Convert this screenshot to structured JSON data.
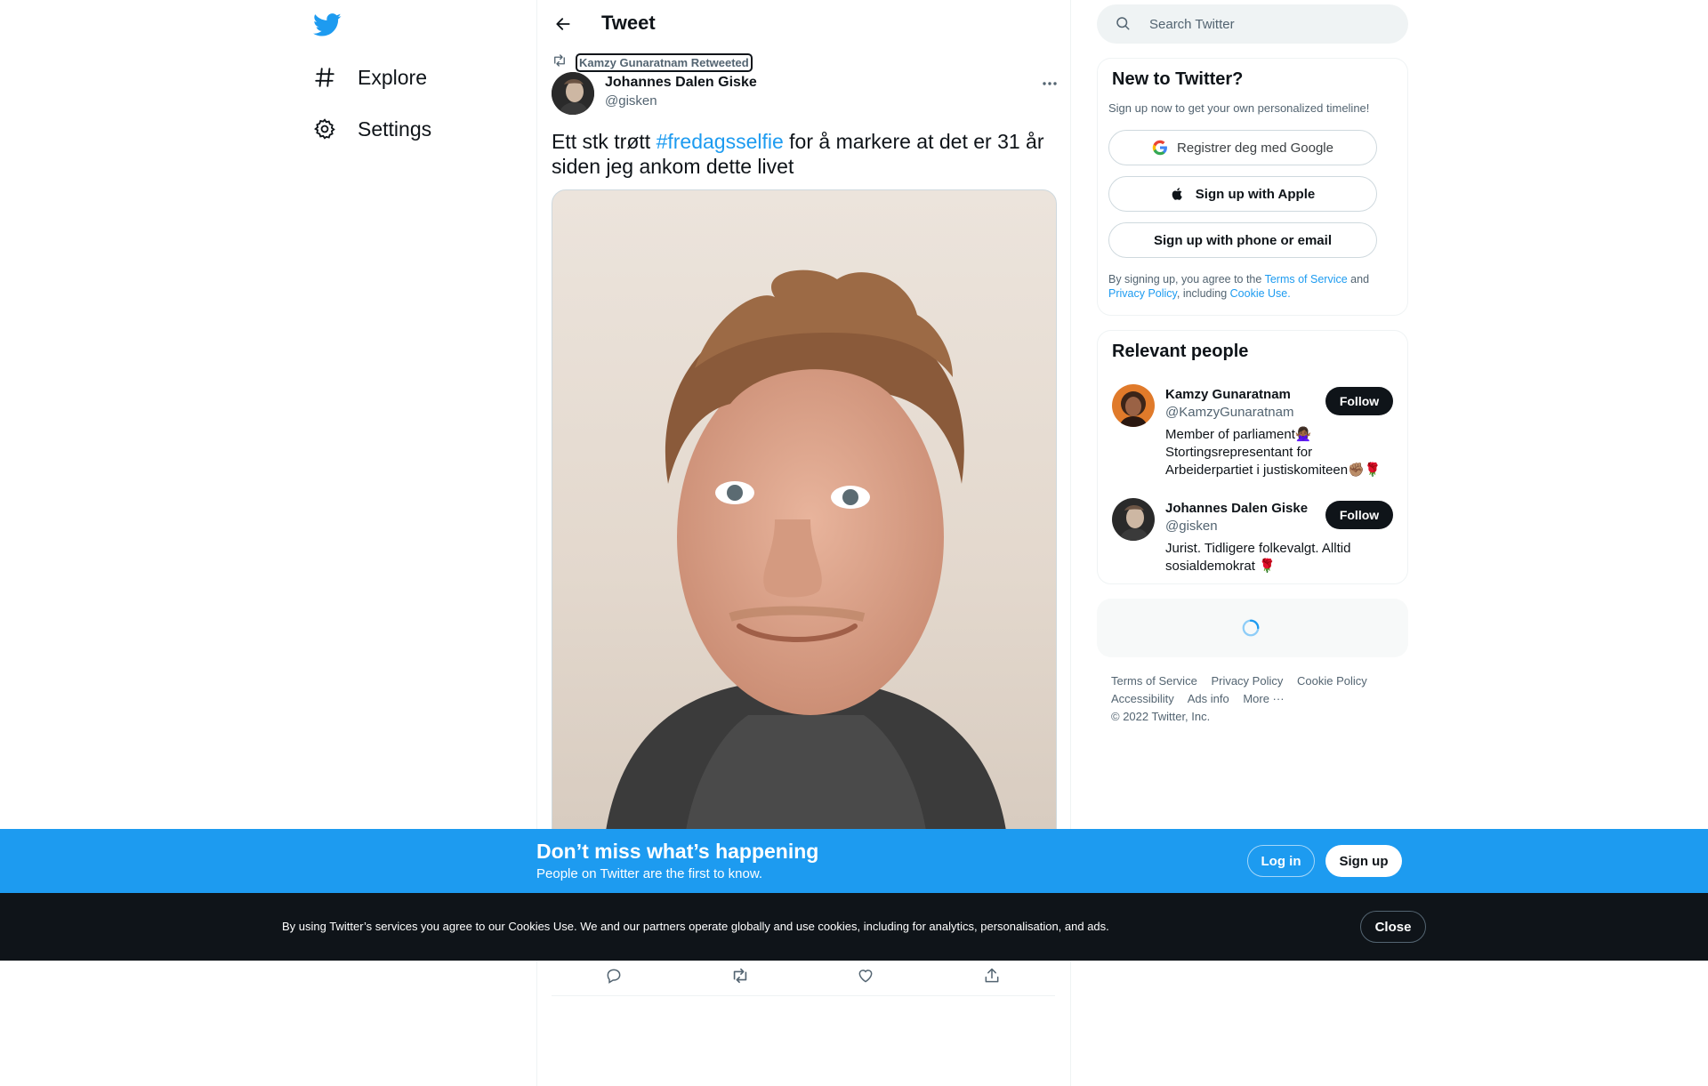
{
  "nav": {
    "items": [
      {
        "label": "Explore",
        "icon": "hashtag-icon"
      },
      {
        "label": "Settings",
        "icon": "gear-icon"
      }
    ]
  },
  "header": {
    "title": "Tweet"
  },
  "tweet": {
    "retweeted_by": "Kamzy Gunaratnam Retweeted",
    "author_name": "Johannes Dalen Giske",
    "author_handle": "@gisken",
    "text_before": "Ett stk trøtt ",
    "hashtag": "#fredagsselfie",
    "text_after": " for å markere at det er 31 år siden jeg ankom dette livet"
  },
  "search": {
    "placeholder": "Search Twitter"
  },
  "new_to_twitter": {
    "title": "New to Twitter?",
    "subtitle": "Sign up now to get your own personalized timeline!",
    "google_label": "Registrer deg med Google",
    "apple_label": "Sign up with Apple",
    "phone_label": "Sign up with phone or email",
    "terms_prefix": "By signing up, you agree to the ",
    "terms_link": "Terms of Service",
    "terms_and": " and",
    "privacy_link": "Privacy Policy",
    "including": ", including ",
    "cookie_link": "Cookie Use."
  },
  "relevant_people": {
    "title": "Relevant people",
    "people": [
      {
        "name": "Kamzy Gunaratnam",
        "handle": "@KamzyGunaratnam",
        "bio": "Member of parliament🙅🏾‍♀️ Stortingsrepresentant for Arbeiderpartiet i justiskomiteen✊🏽🌹",
        "follow": "Follow"
      },
      {
        "name": "Johannes Dalen Giske",
        "handle": "@gisken",
        "bio": "Jurist. Tidligere folkevalgt. Alltid sosialdemokrat 🌹",
        "follow": "Follow"
      }
    ]
  },
  "footer": {
    "links": [
      "Terms of Service",
      "Privacy Policy",
      "Cookie Policy",
      "Accessibility",
      "Ads info",
      "More ···"
    ],
    "copyright": "© 2022 Twitter, Inc."
  },
  "banner": {
    "title": "Don’t miss what’s happening",
    "subtitle": "People on Twitter are the first to know.",
    "login": "Log in",
    "signup": "Sign up"
  },
  "cookie": {
    "text": "By using Twitter’s services you agree to our Cookies Use. We and our partners operate globally and use cookies, including for analytics, personalisation, and ads.",
    "close": "Close"
  },
  "colors": {
    "accent": "#1d9bf0",
    "dark": "#0f1419",
    "muted": "#536471"
  }
}
